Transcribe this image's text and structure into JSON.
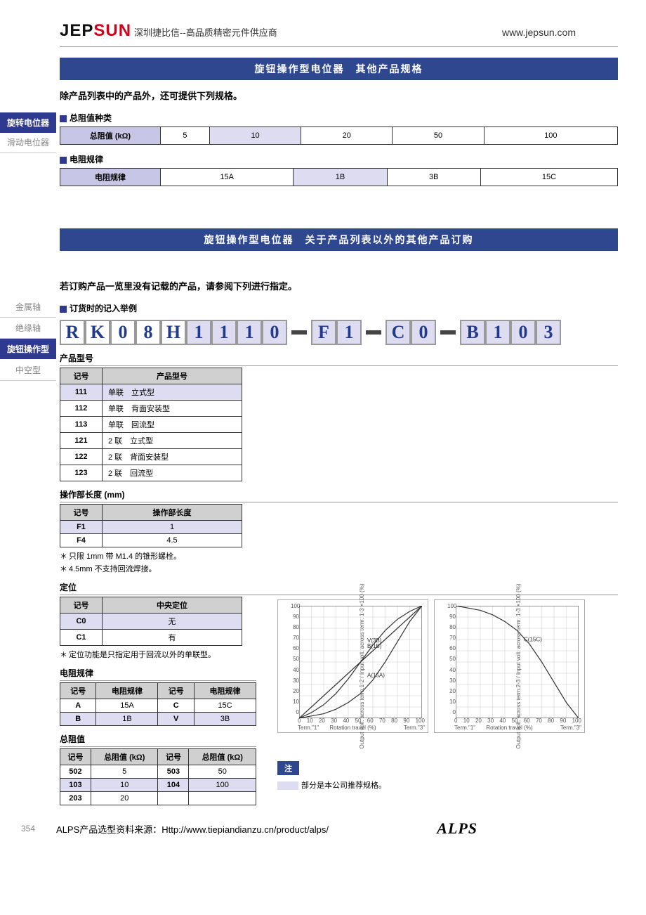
{
  "header": {
    "logo_a": "JEP",
    "logo_b": "SUN",
    "slogan": "深圳捷比信--高品质精密元件供应商",
    "url": "www.jepsun.com"
  },
  "side_nav_1": {
    "active": "旋转电位器",
    "other": "滑动电位器"
  },
  "side_nav_2": {
    "items": [
      "金属轴",
      "绝缘轴",
      "旋钮操作型",
      "中空型"
    ],
    "active_index": 2
  },
  "section1": {
    "title": "旋钮操作型电位器　其他产品规格",
    "intro": "除产品列表中的产品外，还可提供下列规格。",
    "t1_label": "总阻值种类",
    "t1_header": "总阻值 (kΩ)",
    "t1_values": [
      "5",
      "10",
      "20",
      "50",
      "100"
    ],
    "t1_hl_index": 1,
    "t2_label": "电阻规律",
    "t2_header": "电阻规律",
    "t2_values": [
      "15A",
      "1B",
      "3B",
      "15C"
    ],
    "t2_hl_index": 1
  },
  "section2": {
    "title": "旋钮操作型电位器　关于产品列表以外的其他产品订购",
    "intro": "若订购产品一览里没有记载的产品，请参阅下列进行指定。",
    "order_label": "订货时的记入举例",
    "part_chars": [
      "R",
      "K",
      "0",
      "8",
      "H",
      "1",
      "1",
      "1",
      "0",
      "F",
      "1",
      "C",
      "0",
      "B",
      "1",
      "0",
      "3"
    ],
    "grey_start": 5
  },
  "product_type": {
    "label": "产品型号",
    "headers": [
      "记号",
      "产品型号"
    ],
    "rows": [
      {
        "code": "111",
        "desc": "单联　立式型",
        "hl": true
      },
      {
        "code": "112",
        "desc": "单联　背面安装型"
      },
      {
        "code": "113",
        "desc": "单联　回流型"
      },
      {
        "code": "121",
        "desc": "2 联　立式型"
      },
      {
        "code": "122",
        "desc": "2 联　背面安装型"
      },
      {
        "code": "123",
        "desc": "2 联　回流型"
      }
    ]
  },
  "op_length": {
    "label": "操作部长度 (mm)",
    "headers": [
      "记号",
      "操作部长度"
    ],
    "rows": [
      {
        "code": "F1",
        "desc": "1",
        "hl": true
      },
      {
        "code": "F4",
        "desc": "4.5"
      }
    ],
    "notes": [
      "只限 1mm 带 M1.4 的锥形螺栓。",
      "4.5mm 不支持回流焊接。"
    ]
  },
  "detent": {
    "label": "定位",
    "headers": [
      "记号",
      "中央定位"
    ],
    "rows": [
      {
        "code": "C0",
        "desc": "无",
        "hl": true
      },
      {
        "code": "C1",
        "desc": "有"
      }
    ],
    "note": "定位功能是只指定用于回流以外的单联型。"
  },
  "taper": {
    "label": "电阻规律",
    "headers": [
      "记号",
      "电阻规律",
      "记号",
      "电阻规律"
    ],
    "rows": [
      {
        "c1": "A",
        "v1": "15A",
        "c2": "C",
        "v2": "15C"
      },
      {
        "c1": "B",
        "v1": "1B",
        "c2": "V",
        "v2": "3B",
        "hl": true
      }
    ]
  },
  "total_r": {
    "label": "总阻值",
    "headers": [
      "记号",
      "总阻值 (kΩ)",
      "记号",
      "总阻值 (kΩ)"
    ],
    "rows": [
      {
        "c1": "502",
        "v1": "5",
        "c2": "503",
        "v2": "50"
      },
      {
        "c1": "103",
        "v1": "10",
        "c2": "104",
        "v2": "100",
        "hl": true
      },
      {
        "c1": "203",
        "v1": "20",
        "c2": "",
        "v2": ""
      }
    ]
  },
  "notebox": {
    "badge": "注",
    "text": "部分是本公司推荐规格。"
  },
  "charts_common": {
    "ylabel": "Output volt. across term.1-2 / Input volt. across term. 1-3  ×100 (%)",
    "ylabel2": "Output volt. across term.2-3 / Input volt. across term. 1-3  ×100 (%)",
    "xlabel": "Rotation travel (%)",
    "term_l": "Term.\"1\"",
    "term_r": "Term.\"3\"",
    "yticks": [
      "100",
      "90",
      "80",
      "70",
      "60",
      "50",
      "40",
      "30",
      "20",
      "10",
      "0"
    ],
    "xticks": [
      "0",
      "10",
      "20",
      "30",
      "40",
      "50",
      "60",
      "70",
      "80",
      "90",
      "100"
    ]
  },
  "chart_data": [
    {
      "type": "line",
      "title": "",
      "xlabel": "Rotation travel (%)",
      "ylabel": "Output volt ratio ×100 (%)",
      "xlim": [
        0,
        100
      ],
      "ylim": [
        0,
        100
      ],
      "x": [
        0,
        10,
        20,
        30,
        40,
        50,
        60,
        70,
        80,
        90,
        100
      ],
      "series": [
        {
          "name": "B(1B)",
          "values": [
            0,
            10,
            20,
            30,
            40,
            50,
            60,
            70,
            80,
            90,
            100
          ]
        },
        {
          "name": "V(3B)",
          "values": [
            0,
            5,
            12,
            22,
            35,
            50,
            65,
            78,
            88,
            95,
            100
          ]
        },
        {
          "name": "A(15A)",
          "values": [
            0,
            2,
            4,
            8,
            14,
            22,
            34,
            50,
            68,
            86,
            100
          ]
        }
      ]
    },
    {
      "type": "line",
      "title": "",
      "xlabel": "Rotation travel (%)",
      "ylabel": "Output volt ratio ×100 (%)",
      "xlim": [
        0,
        100
      ],
      "ylim": [
        0,
        100
      ],
      "x": [
        0,
        10,
        20,
        30,
        40,
        50,
        60,
        70,
        80,
        90,
        100
      ],
      "series": [
        {
          "name": "C(15C)",
          "values": [
            100,
            98,
            96,
            92,
            86,
            78,
            66,
            50,
            32,
            14,
            0
          ]
        }
      ]
    }
  ],
  "footer": {
    "page": "354",
    "text": "ALPS产品选型资料来源：Http://www.tiepiandianzu.cn/product/alps/",
    "brand": "ALPS"
  }
}
